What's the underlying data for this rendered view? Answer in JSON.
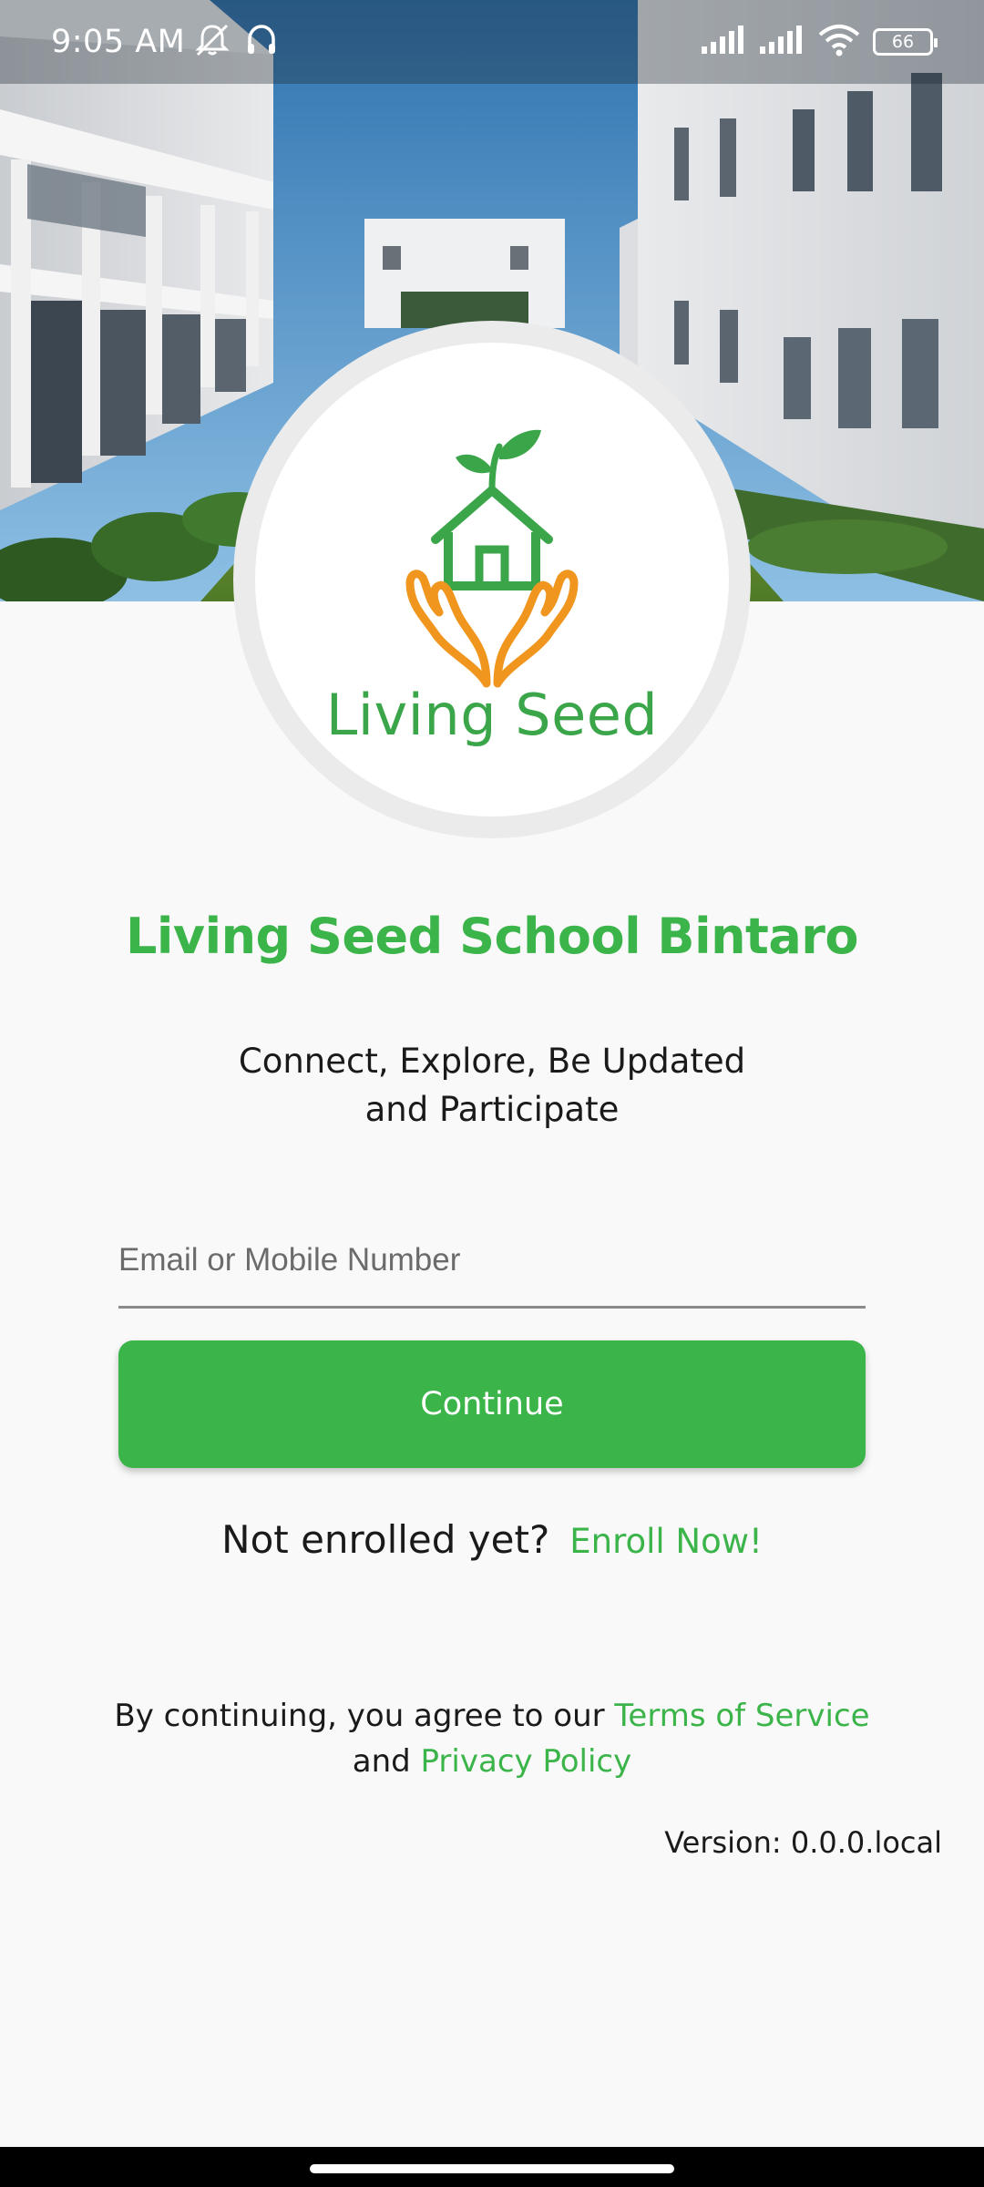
{
  "status_bar": {
    "time": "9:05 AM",
    "battery": "66",
    "icons": [
      "notifications-off-icon",
      "headset-icon",
      "signal-icon",
      "signal-icon",
      "wifi-icon",
      "battery-icon"
    ]
  },
  "hero": {
    "image": "school-building-courtyard"
  },
  "logo": {
    "text": "Living Seed",
    "icon": "house-sprout-hands-icon"
  },
  "school_name": "Living Seed School Bintaro",
  "tagline": {
    "line1": "Connect, Explore, Be Updated",
    "line2": "and Participate"
  },
  "login": {
    "placeholder": "Email or Mobile Number",
    "value": "",
    "continue_label": "Continue"
  },
  "enroll": {
    "question": "Not enrolled yet?",
    "link": "Enroll Now!"
  },
  "terms": {
    "prefix": "By continuing, you agree to our ",
    "terms_link": "Terms of Service",
    "and": "and ",
    "privacy_link": "Privacy Policy"
  },
  "version": "Version: 0.0.0.local",
  "colors": {
    "brand_green": "#3bb44a",
    "logo_orange": "#f0961e",
    "background": "#f9f9f9"
  }
}
